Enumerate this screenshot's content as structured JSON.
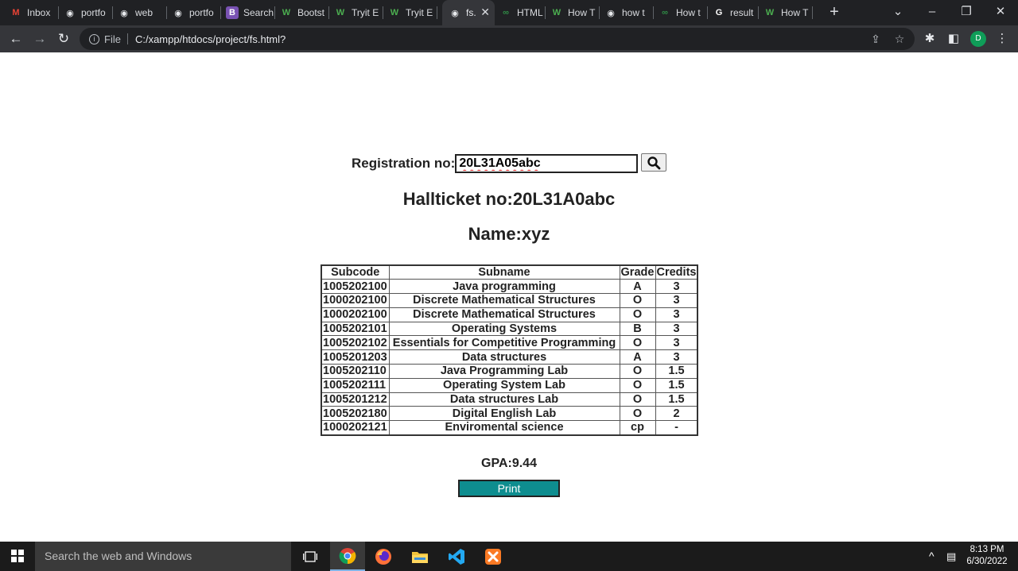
{
  "browser": {
    "tabs": [
      {
        "label": "Inbox",
        "icon": "gmail-icon"
      },
      {
        "label": "portfo",
        "icon": "globe-icon"
      },
      {
        "label": "web",
        "icon": "globe-icon"
      },
      {
        "label": "portfo",
        "icon": "globe-icon"
      },
      {
        "label": "Search",
        "icon": "bootstrap-icon"
      },
      {
        "label": "Bootst",
        "icon": "w3schools-icon"
      },
      {
        "label": "Tryit E",
        "icon": "w3schools-icon"
      },
      {
        "label": "Tryit E",
        "icon": "w3schools-icon"
      },
      {
        "label": "fs.",
        "icon": "globe-icon",
        "active": true
      },
      {
        "label": "HTML",
        "icon": "tutorial-icon"
      },
      {
        "label": "How T",
        "icon": "w3schools-icon"
      },
      {
        "label": "how t",
        "icon": "globe-icon"
      },
      {
        "label": "How t",
        "icon": "tutorial-icon"
      },
      {
        "label": "result",
        "icon": "google-icon"
      },
      {
        "label": "How T",
        "icon": "w3schools-icon"
      }
    ],
    "url_scheme": "File",
    "url": "C:/xampp/htdocs/project/fs.html?",
    "profile_initial": "D"
  },
  "form": {
    "registration_label": "Registration no:",
    "registration_value": "20L31A05abc"
  },
  "student": {
    "hallticket": "Hallticket no:20L31A0abc",
    "name": "Name:xyz"
  },
  "results": {
    "headers": [
      "Subcode",
      "Subname",
      "Grade",
      "Credits"
    ],
    "rows": [
      [
        "1005202100",
        "Java programming",
        "A",
        "3"
      ],
      [
        "1000202100",
        "Discrete Mathematical Structures",
        "O",
        "3"
      ],
      [
        "1000202100",
        "Discrete Mathematical Structures",
        "O",
        "3"
      ],
      [
        "1005202101",
        "Operating Systems",
        "B",
        "3"
      ],
      [
        "1005202102",
        "Essentials for Competitive Programming",
        "O",
        "3"
      ],
      [
        "1005201203",
        "Data structures",
        "A",
        "3"
      ],
      [
        "1005202110",
        "Java Programming Lab",
        "O",
        "1.5"
      ],
      [
        "1005202111",
        "Operating System Lab",
        "O",
        "1.5"
      ],
      [
        "1005201212",
        "Data structures Lab",
        "O",
        "1.5"
      ],
      [
        "1005202180",
        "Digital English Lab",
        "O",
        "2"
      ],
      [
        "1000202121",
        "Enviromental science",
        "cp",
        "-"
      ]
    ]
  },
  "gpa": "GPA:9.44",
  "print_label": "Print",
  "taskbar": {
    "search_placeholder": "Search the web and Windows",
    "time": "8:13 PM",
    "date": "6/30/2022"
  },
  "colors": {
    "print_button": "#0e8d8f",
    "browser_dark": "#202124",
    "toolbar": "#35363a"
  }
}
